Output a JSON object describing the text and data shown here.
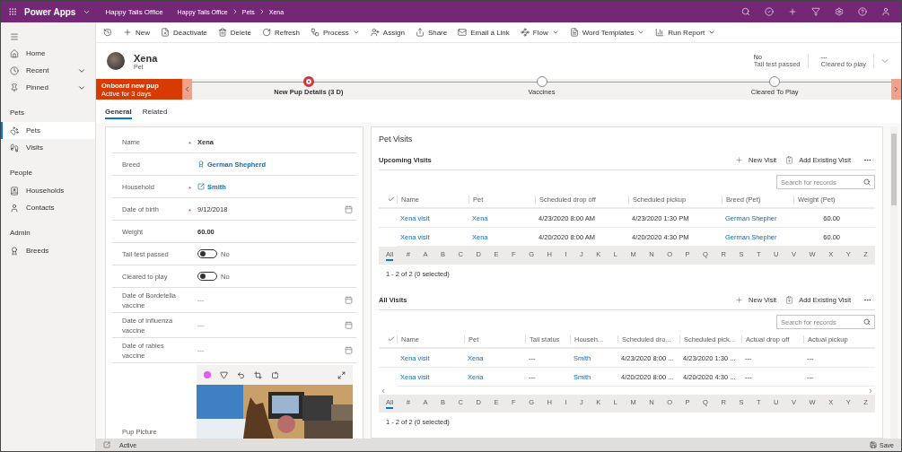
{
  "top_bar": {
    "app_name": "Power Apps",
    "environment": "Happy Tails Office",
    "breadcrumb": [
      "Happy Tails Office",
      "Pets",
      "Xena"
    ]
  },
  "sidebar": {
    "top": [
      {
        "label": "Home",
        "kind": "link"
      },
      {
        "label": "Recent",
        "kind": "menu",
        "expanded": false
      },
      {
        "label": "Pinned",
        "kind": "menu",
        "expanded": false
      }
    ],
    "groups": [
      {
        "title": "Pets",
        "items": [
          {
            "label": "Pets",
            "selected": true
          },
          {
            "label": "Visits",
            "selected": false
          }
        ]
      },
      {
        "title": "People",
        "items": [
          {
            "label": "Households",
            "selected": false
          },
          {
            "label": "Contacts",
            "selected": false
          }
        ]
      },
      {
        "title": "Admin",
        "items": [
          {
            "label": "Breeds",
            "selected": false
          }
        ]
      }
    ]
  },
  "commands": [
    {
      "label": "New",
      "dropdown": false
    },
    {
      "label": "Deactivate",
      "dropdown": false
    },
    {
      "label": "Delete",
      "dropdown": false
    },
    {
      "label": "Refresh",
      "dropdown": false
    },
    {
      "label": "Process",
      "dropdown": true
    },
    {
      "label": "Assign",
      "dropdown": false
    },
    {
      "label": "Share",
      "dropdown": false
    },
    {
      "label": "Email a Link",
      "dropdown": false
    },
    {
      "label": "Flow",
      "dropdown": true
    },
    {
      "label": "Word Templates",
      "dropdown": true
    },
    {
      "label": "Run Report",
      "dropdown": true
    }
  ],
  "record": {
    "name": "Xena",
    "entity": "Pet",
    "header_fields": [
      {
        "value": "No",
        "label": "Tail test passed"
      },
      {
        "value": "---",
        "label": "Cleared to play"
      }
    ]
  },
  "process": {
    "title": "Onboard new pup",
    "duration": "Active for 3 days",
    "stages": [
      {
        "label": "New Pup Details (3 D)",
        "selected": true
      },
      {
        "label": "Vaccines",
        "selected": false
      },
      {
        "label": "Cleared To Play",
        "selected": false
      }
    ]
  },
  "tabs": [
    {
      "label": "General",
      "selected": true
    },
    {
      "label": "Related",
      "selected": false
    }
  ],
  "form": {
    "fields": [
      {
        "label": "Name",
        "kind": "text",
        "required_mark": "*",
        "value": "Xena"
      },
      {
        "label": "Breed",
        "kind": "lookup",
        "value": "German Shepherd"
      },
      {
        "label": "Household",
        "kind": "lookup",
        "required_mark": "*",
        "value": "Smith"
      },
      {
        "label": "Date of birth",
        "kind": "date",
        "required_mark": "*",
        "value": "9/12/2018"
      },
      {
        "label": "Weight",
        "kind": "text",
        "value": "60.00"
      },
      {
        "label": "Tail test passed",
        "kind": "toggle",
        "on": false,
        "value": "No"
      },
      {
        "label": "Cleared to play",
        "kind": "toggle",
        "on": false,
        "value": "No"
      },
      {
        "label": "Date of Bordetella vaccine",
        "kind": "date",
        "value": "---"
      },
      {
        "label": "Date of influenza vaccine",
        "kind": "date",
        "value": "---"
      },
      {
        "label": "Date of rabies vaccine",
        "kind": "date",
        "value": "---"
      },
      {
        "label": "Pup Picture"
      }
    ]
  },
  "pet_visits": {
    "title": "Pet Visits",
    "subgrids": [
      {
        "title": "Upcoming Visits",
        "actions": [
          "New Visit",
          "Add Existing Visit"
        ],
        "search_placeholder": "Search for records",
        "columns": [
          {
            "label": "Name",
            "kind": "link"
          },
          {
            "label": "Pet",
            "kind": "link"
          },
          {
            "label": "Scheduled drop off",
            "kind": "text"
          },
          {
            "label": "Scheduled pickup",
            "kind": "text"
          },
          {
            "label": "Breed (Pet)",
            "kind": "link"
          },
          {
            "label": "Weight (Pet)",
            "kind": "number"
          }
        ],
        "rows": [
          [
            "Xena visit",
            "Xena",
            "4/23/2020 8:00 AM",
            "4/23/2020 1:30 PM",
            "German Shepher",
            "60.00"
          ],
          [
            "Xena visit",
            "Xena",
            "4/20/2020 8:00 AM",
            "4/20/2020 4:30 PM",
            "German Shepher",
            "60.00"
          ]
        ],
        "letters": [
          {
            "label": "All",
            "selected": true
          },
          {
            "label": "#",
            "selected": false
          },
          {
            "label": "A",
            "selected": false
          },
          {
            "label": "B",
            "selected": false
          },
          {
            "label": "C",
            "selected": false
          },
          {
            "label": "D",
            "selected": false
          },
          {
            "label": "E",
            "selected": false
          },
          {
            "label": "F",
            "selected": false
          },
          {
            "label": "G",
            "selected": false
          },
          {
            "label": "H",
            "selected": false
          },
          {
            "label": "I",
            "selected": false
          },
          {
            "label": "J",
            "selected": false
          },
          {
            "label": "K",
            "selected": false
          },
          {
            "label": "L",
            "selected": false
          },
          {
            "label": "M",
            "selected": false
          },
          {
            "label": "N",
            "selected": false
          },
          {
            "label": "O",
            "selected": false
          },
          {
            "label": "P",
            "selected": false
          },
          {
            "label": "Q",
            "selected": false
          },
          {
            "label": "R",
            "selected": false
          },
          {
            "label": "S",
            "selected": false
          },
          {
            "label": "T",
            "selected": false
          },
          {
            "label": "U",
            "selected": false
          },
          {
            "label": "V",
            "selected": false
          },
          {
            "label": "W",
            "selected": false
          },
          {
            "label": "X",
            "selected": false
          },
          {
            "label": "Y",
            "selected": false
          },
          {
            "label": "Z",
            "selected": false
          }
        ],
        "footer": "1 - 2 of 2 (0 selected)"
      },
      {
        "title": "All Visits",
        "actions": [
          "New Visit",
          "Add Existing Visit"
        ],
        "search_placeholder": "Search for records",
        "columns": [
          {
            "label": "Name",
            "kind": "link"
          },
          {
            "label": "Pet",
            "kind": "link"
          },
          {
            "label": "Tail status",
            "kind": "text"
          },
          {
            "label": "Househ...",
            "kind": "link"
          },
          {
            "label": "Scheduled dro...",
            "kind": "text"
          },
          {
            "label": "Scheduled pick...",
            "kind": "text"
          },
          {
            "label": "Actual drop off",
            "kind": "text"
          },
          {
            "label": "Actual pickup",
            "kind": "text"
          }
        ],
        "rows": [
          [
            "Xena visit",
            "Xena",
            "---",
            "Smith",
            "4/23/2020 8:00 ...",
            "4/23/2020 1:30 ...",
            "---",
            "---"
          ],
          [
            "Xena visit",
            "Xena",
            "---",
            "Smith",
            "4/20/2020 8:00 ...",
            "4/20/2020 4:30 ...",
            "---",
            "---"
          ]
        ],
        "letters": [
          {
            "label": "All",
            "selected": true
          },
          {
            "label": "#",
            "selected": false
          },
          {
            "label": "A",
            "selected": false
          },
          {
            "label": "B",
            "selected": false
          },
          {
            "label": "C",
            "selected": false
          },
          {
            "label": "D",
            "selected": false
          },
          {
            "label": "E",
            "selected": false
          },
          {
            "label": "F",
            "selected": false
          },
          {
            "label": "G",
            "selected": false
          },
          {
            "label": "H",
            "selected": false
          },
          {
            "label": "I",
            "selected": false
          },
          {
            "label": "J",
            "selected": false
          },
          {
            "label": "K",
            "selected": false
          },
          {
            "label": "L",
            "selected": false
          },
          {
            "label": "M",
            "selected": false
          },
          {
            "label": "N",
            "selected": false
          },
          {
            "label": "O",
            "selected": false
          },
          {
            "label": "P",
            "selected": false
          },
          {
            "label": "Q",
            "selected": false
          },
          {
            "label": "R",
            "selected": false
          },
          {
            "label": "S",
            "selected": false
          },
          {
            "label": "T",
            "selected": false
          },
          {
            "label": "U",
            "selected": false
          },
          {
            "label": "V",
            "selected": false
          },
          {
            "label": "W",
            "selected": false
          },
          {
            "label": "X",
            "selected": false
          },
          {
            "label": "Y",
            "selected": false
          },
          {
            "label": "Z",
            "selected": false
          }
        ],
        "footer": "1 - 2 of 2 (0 selected)"
      }
    ]
  },
  "status_bar": {
    "status": "Active",
    "save": "Save"
  }
}
